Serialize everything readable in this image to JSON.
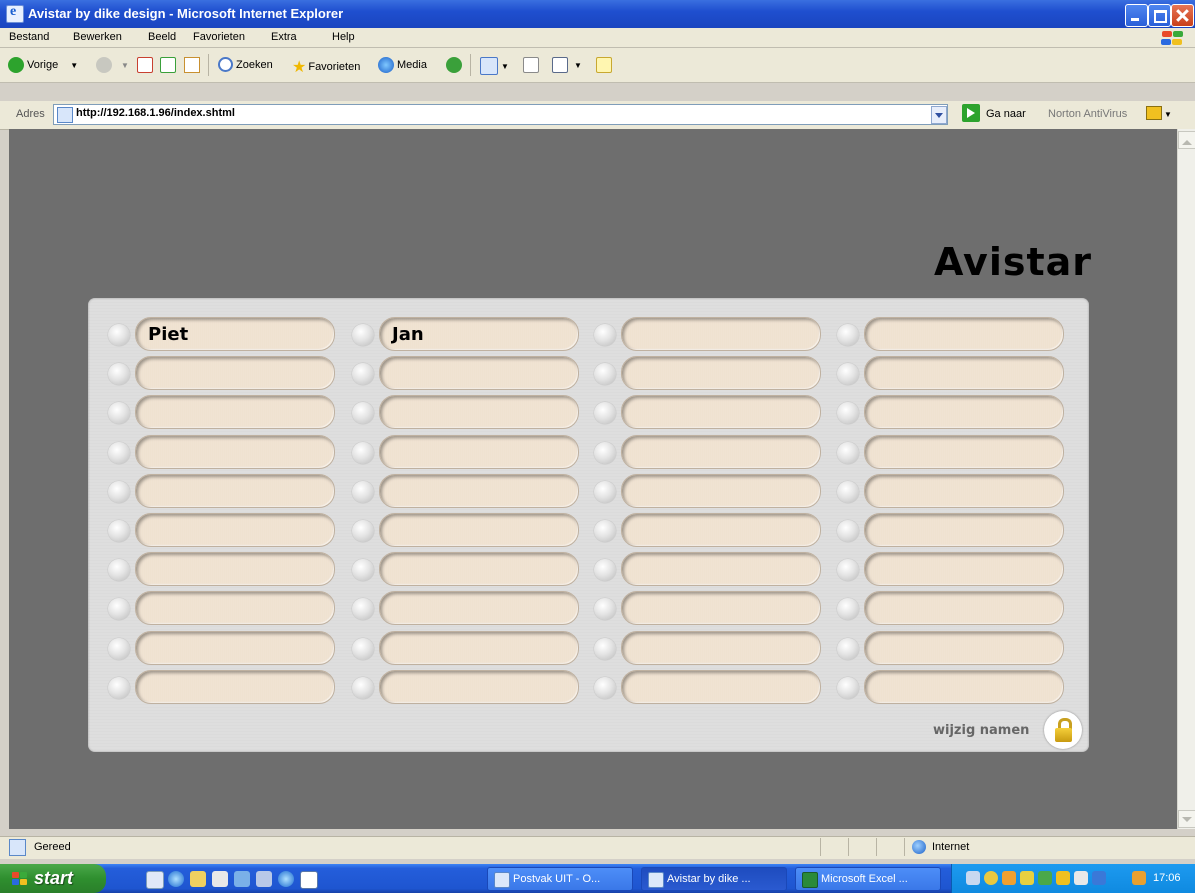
{
  "window": {
    "title": "Avistar by dike design - Microsoft Internet Explorer"
  },
  "menu": [
    "Bestand",
    "Bewerken",
    "Beeld",
    "Favorieten",
    "Extra",
    "Help"
  ],
  "toolbar": {
    "back": "Vorige",
    "search": "Zoeken",
    "favorites": "Favorieten",
    "media": "Media"
  },
  "address": {
    "label": "Adres",
    "url": "http://192.168.1.96/index.shtml",
    "go": "Ga naar",
    "norton": "Norton AntiVirus"
  },
  "app": {
    "title": "Avistar",
    "edit_names": "wijzig namen",
    "grid": [
      [
        "Piet",
        "Jan",
        "",
        ""
      ],
      [
        "",
        "",
        "",
        ""
      ],
      [
        "",
        "",
        "",
        ""
      ],
      [
        "",
        "",
        "",
        ""
      ],
      [
        "",
        "",
        "",
        ""
      ],
      [
        "",
        "",
        "",
        ""
      ],
      [
        "",
        "",
        "",
        ""
      ],
      [
        "",
        "",
        "",
        ""
      ],
      [
        "",
        "",
        "",
        ""
      ],
      [
        "",
        "",
        "",
        ""
      ]
    ]
  },
  "status": {
    "text": "Gereed",
    "zone": "Internet"
  },
  "taskbar": {
    "start": "start",
    "tasks": [
      "Postvak UIT - O...",
      "Avistar by dike ...",
      "Microsoft Excel ..."
    ],
    "clock": "17:06"
  }
}
